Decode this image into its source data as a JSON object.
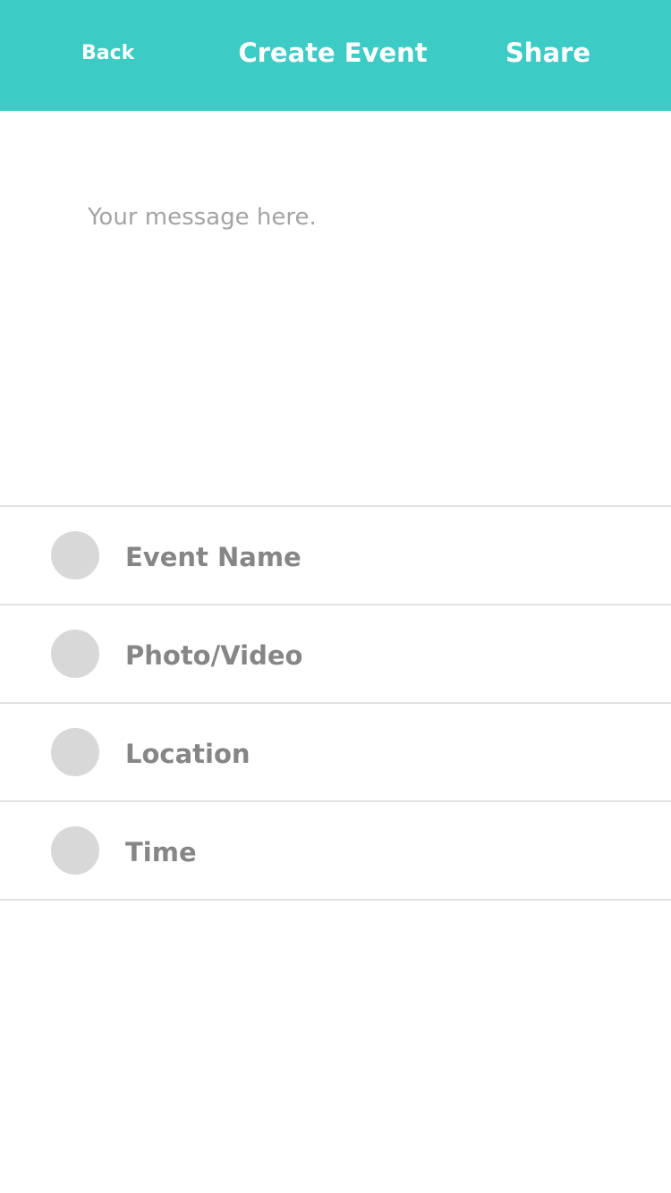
{
  "header": {
    "back_label": "Back",
    "title": "Create Event",
    "share_label": "Share"
  },
  "message": {
    "placeholder": "Your message here.",
    "value": ""
  },
  "options": [
    {
      "label": "Event Name"
    },
    {
      "label": "Photo/Video"
    },
    {
      "label": "Location"
    },
    {
      "label": "Time"
    }
  ],
  "colors": {
    "header_bg": "#3ccbc5",
    "header_text": "#ffffff",
    "option_dot": "#d8d8d8",
    "option_text": "#868686",
    "divider": "#e2e2e2",
    "placeholder_text": "#a4a4a4"
  }
}
